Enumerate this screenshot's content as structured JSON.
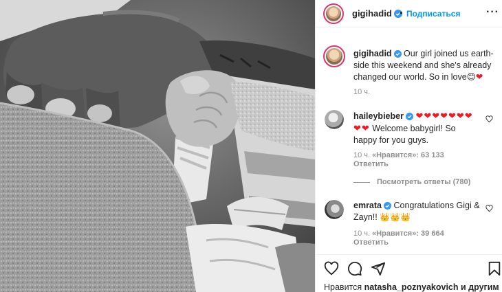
{
  "post": {
    "author": "gigihadid",
    "follow_label": "Подписаться",
    "caption_author": "gigihadid",
    "caption_text": "Our girl joined us earth-side this weekend and she's already changed our world. So in love",
    "caption_emoji": "😊",
    "caption_heart": "❤",
    "caption_time": "10 ч."
  },
  "comments": [
    {
      "user": "haileybieber",
      "hearts": "❤❤❤❤❤❤❤❤❤",
      "text": "Welcome babygirl! So happy for you guys.",
      "time": "10 ч.",
      "likes": "«Нравится»: 63 133",
      "reply_label": "Ответить",
      "view_replies": "Посмотреть ответы (780)"
    },
    {
      "user": "emrata",
      "text": "Congratulations Gigi & Zayn!!",
      "crowns": "👑👑👑",
      "time": "10 ч.",
      "likes": "«Нравится»: 39 664",
      "reply_label": "Ответить"
    }
  ],
  "footer": {
    "likes_prefix": "Нравится",
    "likes_user": "natasha_poznyakovich",
    "likes_suffix": "и другим"
  },
  "icons": {
    "more": "more-options-icon",
    "verified": "verified-badge-icon",
    "like": "heart-icon",
    "comment": "comment-icon",
    "share": "share-icon",
    "save": "bookmark-icon"
  },
  "colors": {
    "accent": "#0095f6",
    "verified": "#3897f0",
    "heart_emoji": "#ed1c24",
    "story_ring": "#e1306c"
  }
}
